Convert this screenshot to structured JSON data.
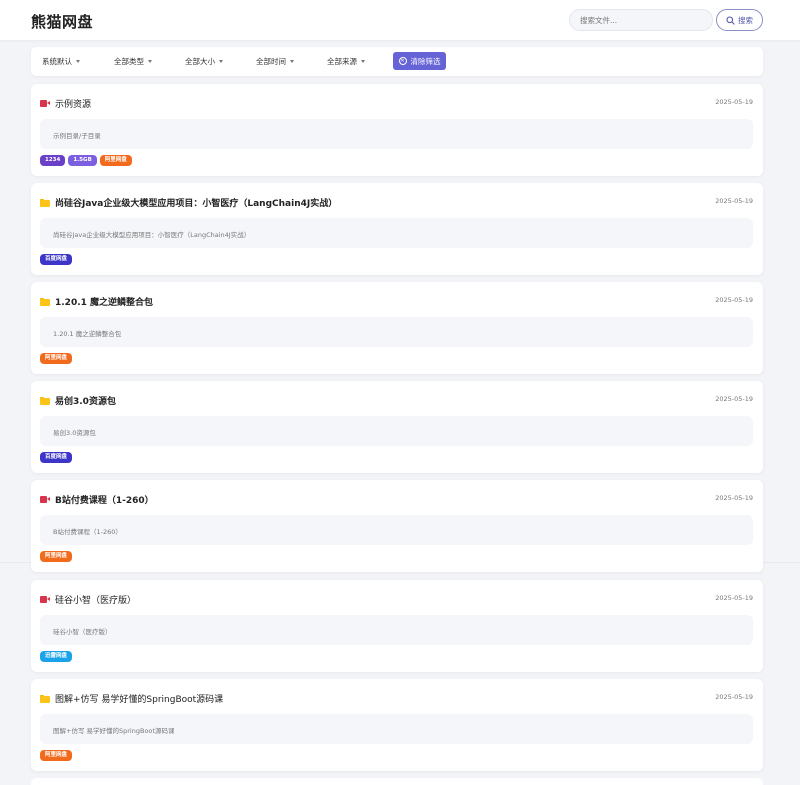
{
  "header": {
    "brand": "熊猫网盘",
    "search_placeholder": "搜索文件...",
    "search_button": "搜索"
  },
  "filters": {
    "sort": "系统默认",
    "type": "全部类型",
    "size": "全部大小",
    "time": "全部时间",
    "source": "全部来源",
    "clear": "清除筛选"
  },
  "colors": {
    "accent": "#6563d6",
    "aliyun": "#f26b1d",
    "baidu": "#3c35c7",
    "xunlei": "#1aa3e8",
    "count_tag": "#6b40c8",
    "size_tag": "#7b5fe0",
    "video_icon": "#d9354a",
    "folder_icon": "#fcc419"
  },
  "items": [
    {
      "icon": "video-icon",
      "title": "示例资源",
      "date": "2025-05-19",
      "desc": "示例目录/子目录",
      "tags": [
        {
          "label": "1234",
          "color": "#6b40c8"
        },
        {
          "label": "1.5GB",
          "color": "#7b5fe0"
        },
        {
          "label": "阿里网盘",
          "color": "#f26b1d"
        }
      ]
    },
    {
      "icon": "folder-icon",
      "title": "尚硅谷Java企业级大模型应用项目：小智医疗（LangChain4J实战）",
      "date": "2025-05-19",
      "desc": "尚硅谷Java企业级大模型应用项目：小智医疗（LangChain4J实战）",
      "tags": [
        {
          "label": "百度网盘",
          "color": "#3c35c7"
        }
      ]
    },
    {
      "icon": "folder-icon",
      "title": "1.20.1 魔之逆鳞整合包",
      "date": "2025-05-19",
      "desc": "1.20.1 魔之逆鳞整合包",
      "tags": [
        {
          "label": "阿里网盘",
          "color": "#f26b1d"
        }
      ]
    },
    {
      "icon": "folder-icon",
      "title": "易创3.0资源包",
      "date": "2025-05-19",
      "desc": "易创3.0资源包",
      "tags": [
        {
          "label": "百度网盘",
          "color": "#3c35c7"
        }
      ]
    },
    {
      "icon": "video-icon",
      "title": "B站付费课程（1-260）",
      "date": "2025-05-19",
      "desc": "B站付费课程（1-260）",
      "tags": [
        {
          "label": "阿里网盘",
          "color": "#f26b1d"
        }
      ]
    },
    {
      "icon": "video-icon",
      "title": "硅谷小智（医疗版）",
      "date": "2025-05-19",
      "desc": "硅谷小智（医疗版）",
      "tags": [
        {
          "label": "迅雷网盘",
          "color": "#1aa3e8"
        }
      ]
    },
    {
      "icon": "folder-icon",
      "title": "图解+仿写 易学好懂的SpringBoot源码课",
      "date": "2025-05-19",
      "desc": "图解+仿写 易学好懂的SpringBoot源码课",
      "tags": [
        {
          "label": "阿里网盘",
          "color": "#f26b1d"
        }
      ]
    }
  ]
}
